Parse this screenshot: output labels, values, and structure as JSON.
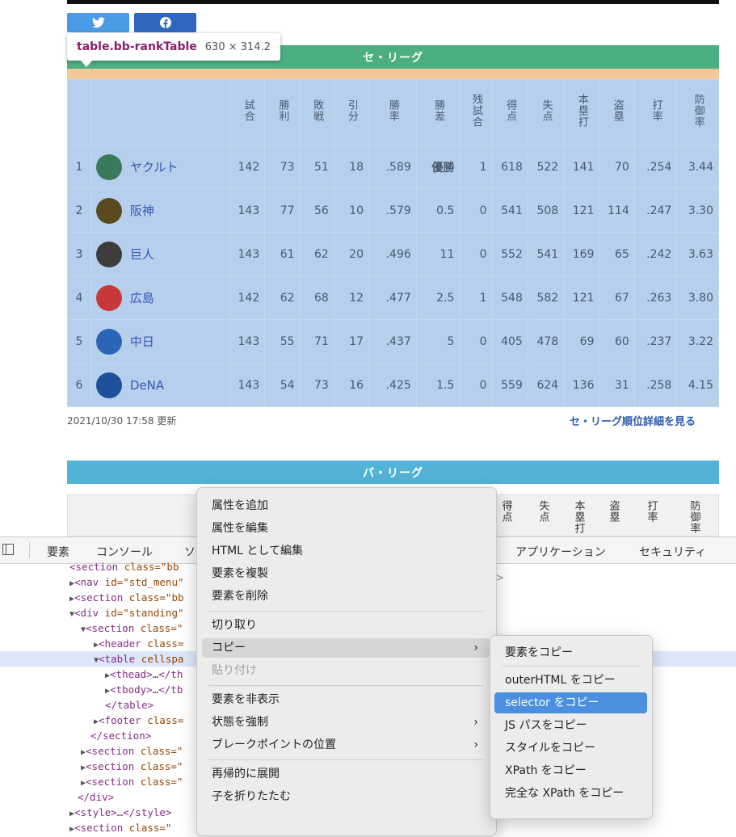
{
  "share": {
    "twitter_icon": "twitter-bird-icon",
    "facebook_icon": "facebook-f-icon"
  },
  "tooltip": {
    "selector_tag": "table",
    "selector_class": ".bb-rankTable",
    "dims": "630 × 314.2"
  },
  "central": {
    "title": "セ・リーグ",
    "headers": [
      "試合",
      "勝利",
      "敗戦",
      "引分",
      "勝率",
      "勝差",
      "残試合",
      "得点",
      "失点",
      "本塁打",
      "盗塁",
      "打率",
      "防御率"
    ],
    "rows": [
      {
        "rank": "1",
        "team": "ヤクルト",
        "logo_icon": "swallows-logo-icon",
        "color": "#3a7a5c",
        "cells": [
          "142",
          "73",
          "51",
          "18",
          ".589",
          "優勝",
          "1",
          "618",
          "522",
          "141",
          "70",
          ".254",
          "3.44"
        ]
      },
      {
        "rank": "2",
        "team": "阪神",
        "logo_icon": "tigers-logo-icon",
        "color": "#5a4a20",
        "cells": [
          "143",
          "77",
          "56",
          "10",
          ".579",
          "0.5",
          "0",
          "541",
          "508",
          "121",
          "114",
          ".247",
          "3.30"
        ]
      },
      {
        "rank": "3",
        "team": "巨人",
        "logo_icon": "giants-logo-icon",
        "color": "#3c3c3c",
        "cells": [
          "143",
          "61",
          "62",
          "20",
          ".496",
          "11",
          "0",
          "552",
          "541",
          "169",
          "65",
          ".242",
          "3.63"
        ]
      },
      {
        "rank": "4",
        "team": "広島",
        "logo_icon": "carp-logo-icon",
        "color": "#c8383a",
        "cells": [
          "142",
          "62",
          "68",
          "12",
          ".477",
          "2.5",
          "1",
          "548",
          "582",
          "121",
          "67",
          ".263",
          "3.80"
        ]
      },
      {
        "rank": "5",
        "team": "中日",
        "logo_icon": "dragons-logo-icon",
        "color": "#2a65b8",
        "cells": [
          "143",
          "55",
          "71",
          "17",
          ".437",
          "5",
          "0",
          "405",
          "478",
          "69",
          "60",
          ".237",
          "3.22"
        ]
      },
      {
        "rank": "6",
        "team": "DeNA",
        "logo_icon": "baystars-logo-icon",
        "color": "#1d4f9a",
        "cells": [
          "143",
          "54",
          "73",
          "16",
          ".425",
          "1.5",
          "0",
          "559",
          "624",
          "136",
          "31",
          ".258",
          "4.15"
        ]
      }
    ],
    "updated": "2021/10/30 17:58 更新",
    "detail_link": "セ・リーグ順位詳細を見る"
  },
  "pacific": {
    "title": "パ・リーグ",
    "visible_headers": [
      "得点",
      "失点",
      "本塁打",
      "盗塁",
      "打率",
      "防御率"
    ]
  },
  "devtools": {
    "tabs": [
      "要素",
      "コンソール",
      "ソ",
      "アプリケーション",
      "セキュリティ"
    ],
    "dom_lines": [
      {
        "indent": 86,
        "tri": "",
        "tag": "<section",
        "attr": " class=\"bb",
        "rest": ""
      },
      {
        "indent": 86,
        "tri": "▶",
        "tag": "<nav",
        "attr": " id=\"std_menu\"",
        "rest": ""
      },
      {
        "indent": 86,
        "tri": "▶",
        "tag": "<section",
        "attr": " class=\"bb",
        "rest": ""
      },
      {
        "indent": 86,
        "tri": "▼",
        "tag": "<div",
        "attr": " id=\"standing\"",
        "rest": ""
      },
      {
        "indent": 100,
        "tri": "▼",
        "tag": "<section",
        "attr": " class=\"",
        "rest": ""
      },
      {
        "indent": 116,
        "tri": "▶",
        "tag": "<header",
        "attr": " class=",
        "rest": ""
      },
      {
        "indent": 116,
        "tri": "▼",
        "tag": "<table",
        "attr": " cellspa",
        "rest": "",
        "selected": true
      },
      {
        "indent": 130,
        "tri": "▶",
        "tag": "<thead>",
        "attr": "",
        "rest": "…</th"
      },
      {
        "indent": 130,
        "tri": "▶",
        "tag": "<tbody>",
        "attr": "",
        "rest": "…</tb"
      },
      {
        "indent": 130,
        "tri": "",
        "tag": "</table>",
        "attr": "",
        "rest": ""
      },
      {
        "indent": 116,
        "tri": "▶",
        "tag": "<footer",
        "attr": " class=",
        "rest": ""
      },
      {
        "indent": 112,
        "tri": "",
        "tag": "</section>",
        "attr": "",
        "rest": ""
      },
      {
        "indent": 100,
        "tri": "▶",
        "tag": "<section",
        "attr": " class=\"",
        "rest": ""
      },
      {
        "indent": 100,
        "tri": "▶",
        "tag": "<section",
        "attr": " class=\"",
        "rest": ""
      },
      {
        "indent": 100,
        "tri": "▶",
        "tag": "<section",
        "attr": " class=\"",
        "rest": ""
      },
      {
        "indent": 96,
        "tri": "",
        "tag": "</div>",
        "attr": "",
        "rest": ""
      },
      {
        "indent": 86,
        "tri": "▶",
        "tag": "<style>",
        "attr": "",
        "rest": "…</style>"
      },
      {
        "indent": 86,
        "tri": "▶",
        "tag": "<section",
        "attr": " class=\"",
        "rest": ""
      }
    ],
    "right_glyph": ">"
  },
  "context_menu": {
    "items": [
      {
        "label": "属性を追加"
      },
      {
        "label": "属性を編集"
      },
      {
        "label": "HTML として編集"
      },
      {
        "label": "要素を複製"
      },
      {
        "label": "要素を削除",
        "sep_after": true
      },
      {
        "label": "切り取り"
      },
      {
        "label": "コピー",
        "submenu": true,
        "highlight": true
      },
      {
        "label": "貼り付け",
        "disabled": true,
        "sep_after": true
      },
      {
        "label": "要素を非表示"
      },
      {
        "label": "状態を強制",
        "submenu": true
      },
      {
        "label": "ブレークポイントの位置",
        "submenu": true,
        "sep_after": true
      },
      {
        "label": "再帰的に展開"
      },
      {
        "label": "子を折りたたむ"
      }
    ]
  },
  "copy_submenu": {
    "items": [
      {
        "label": "要素をコピー",
        "sep_after": true
      },
      {
        "label": "outerHTML をコピー"
      },
      {
        "label": "selector をコピー",
        "active": true
      },
      {
        "label": "JS パスをコピー"
      },
      {
        "label": "スタイルをコピー"
      },
      {
        "label": "XPath をコピー"
      },
      {
        "label": "完全な XPath をコピー"
      }
    ]
  }
}
